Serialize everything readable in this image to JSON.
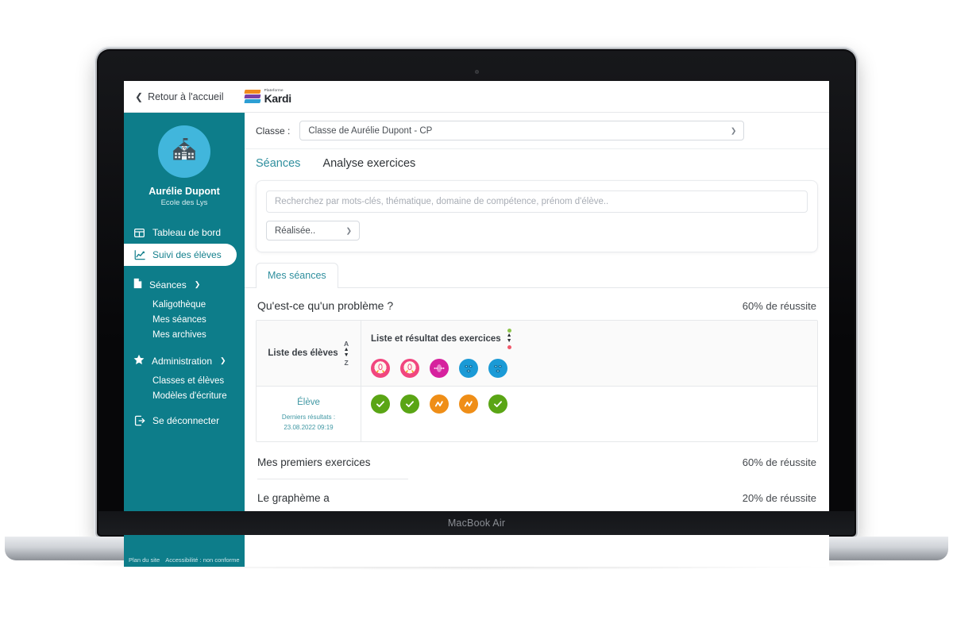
{
  "device": {
    "brand_label": "MacBook Air"
  },
  "topbar": {
    "back_label": "Retour à l'accueil",
    "back_icon": "chevron-left-icon",
    "logo": {
      "kicker": "Plateforme",
      "name": "Kardi"
    }
  },
  "sidebar": {
    "avatar_icon": "school-building-icon",
    "user_name": "Aurélie Dupont",
    "school_name": "Ecole des Lys",
    "items": [
      {
        "label": "Tableau de bord",
        "icon": "dashboard-grid-icon",
        "state": "default",
        "type": "link"
      },
      {
        "label": "Suivi des élèves",
        "icon": "chart-line-icon",
        "state": "active",
        "type": "link"
      },
      {
        "label": "Séances",
        "icon": "document-icon",
        "state": "default",
        "type": "group",
        "caret": "chevron-down-icon"
      },
      {
        "label": "Kaligothèque",
        "type": "sub"
      },
      {
        "label": "Mes séances",
        "type": "sub"
      },
      {
        "label": "Mes archives",
        "type": "sub"
      },
      {
        "label": "Administration",
        "icon": "star-icon",
        "state": "default",
        "type": "group",
        "caret": "chevron-down-icon"
      },
      {
        "label": "Classes et élèves",
        "type": "sub"
      },
      {
        "label": "Modèles d'écriture",
        "type": "sub"
      },
      {
        "label": "Se déconnecter",
        "icon": "logout-icon",
        "state": "default",
        "type": "link"
      }
    ],
    "footer": {
      "site_map": "Plan du site",
      "accessibility": "Accessibilité : non conforme"
    }
  },
  "main": {
    "classe_label": "Classe :",
    "classe_selected": "Classe de Aurélie Dupont - CP",
    "tabs": [
      {
        "label": "Séances",
        "active": true
      },
      {
        "label": "Analyse exercices",
        "active": false
      }
    ],
    "search": {
      "placeholder": "Recherchez par mots-clés, thématique, domaine de compétence, prénom d'élève..",
      "value": "",
      "filter_selected": "Réalisée.."
    },
    "subtab": {
      "label": "Mes séances",
      "active": true
    },
    "session": {
      "title": "Qu'est-ce qu'un problème ?",
      "success_rate": "60% de réussite",
      "columns": {
        "students": {
          "label": "Liste des élèves",
          "sort_top": "A",
          "sort_bottom": "Z"
        },
        "exercises": {
          "label": "Liste et résultat des exercices",
          "sort_top_color": "#8bc34a",
          "sort_bottom_color": "#f0596b"
        }
      },
      "exercise_avatars": [
        {
          "name": "exercise-avatar-1",
          "style": "ex-a1"
        },
        {
          "name": "exercise-avatar-2",
          "style": "ex-a2"
        },
        {
          "name": "exercise-avatar-3",
          "style": "ex-a3"
        },
        {
          "name": "exercise-avatar-4",
          "style": "ex-a4"
        },
        {
          "name": "exercise-avatar-5",
          "style": "ex-a5"
        }
      ],
      "row": {
        "student_name": "Élève",
        "last_results_label": "Derniers résultats :",
        "last_results_value": "23.08.2022 09:19",
        "results": [
          {
            "status": "ok",
            "icon": "check-icon"
          },
          {
            "status": "ok",
            "icon": "check-icon"
          },
          {
            "status": "warn",
            "icon": "zigzag-icon"
          },
          {
            "status": "warn",
            "icon": "zigzag-icon"
          },
          {
            "status": "ok",
            "icon": "check-icon"
          }
        ]
      }
    },
    "other_sessions": [
      {
        "title": "Mes premiers exercices",
        "success_rate": "60% de réussite"
      },
      {
        "title": "Le graphème a",
        "success_rate": "20% de réussite"
      }
    ]
  },
  "colors": {
    "sidebar_teal": "#0d7d8a",
    "accent_teal": "#2f8f9e",
    "avatar_blue": "#41b6dc",
    "success_green": "#5aa515",
    "warn_orange": "#ef8e17",
    "dot_green": "#8bc34a",
    "dot_red": "#f0596b"
  }
}
